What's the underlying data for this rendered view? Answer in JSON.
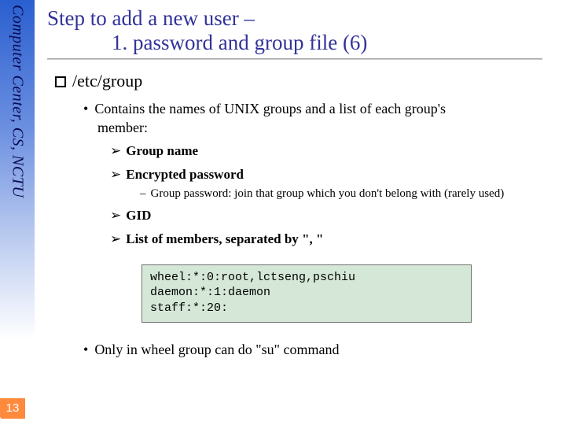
{
  "sidebar": {
    "label": "Computer Center, CS, NCTU"
  },
  "page_number": "13",
  "title": {
    "line1": "Step to add a new user –",
    "line2": "1. password and group file (6)"
  },
  "bullets": {
    "lvl1": "/etc/group",
    "lvl2a_part1": "Contains the names of UNIX groups and a list of each group's",
    "lvl2a_part2": "member:",
    "fields": {
      "f1": "Group name",
      "f2": "Encrypted password",
      "f2_sub": "Group password: join that group which you don't belong with (rarely used)",
      "f3": "GID",
      "f4_prefix": "List of members, separated by ",
      "f4_quote": "\", \""
    },
    "lvl2b": "Only in wheel group can do \"su\" command"
  },
  "code": "wheel:*:0:root,lctseng,pschiu\ndaemon:*:1:daemon\nstaff:*:20:"
}
